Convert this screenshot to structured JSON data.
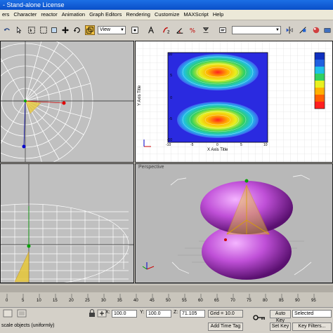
{
  "window": {
    "title": "- Stand-alone License"
  },
  "menu": [
    "ers",
    "Character",
    "reactor",
    "Animation",
    "Graph Editors",
    "Rendering",
    "Customize",
    "MAXScript",
    "Help"
  ],
  "toolbar": {
    "view_dropdown": "View"
  },
  "viewports": {
    "top_right": {
      "x_axis_title": "X Axis Title",
      "y_axis_title": "Y Axis Title",
      "x_ticks": [
        "-10",
        "-5",
        "0",
        "5",
        "10"
      ],
      "y_ticks": [
        "10",
        "5",
        "0",
        "-5",
        "-10"
      ]
    },
    "perspective": {
      "label": "Perspective"
    }
  },
  "timeline": {
    "ticks": [
      "0",
      "5",
      "10",
      "15",
      "20",
      "25",
      "30",
      "35",
      "40",
      "45",
      "50",
      "55",
      "60",
      "65",
      "70",
      "75",
      "80",
      "85",
      "90",
      "95"
    ]
  },
  "status": {
    "prompt": "scale objects (uniformly)",
    "x_label": "X:",
    "x_value": "100.0",
    "y_label": "Y:",
    "y_value": "100.0",
    "z_label": "Z:",
    "z_value": "71.105",
    "grid": "Grid = 10.0",
    "add_time_tag": "Add Time Tag",
    "auto_key": "Auto Key",
    "selected": "Selected",
    "set_key": "Set Key",
    "key_filters": "Key Filters..."
  },
  "colors": {
    "accent": "#f0c040",
    "viewport_bg": "#c0c0c0",
    "sphere": "#c050d8",
    "plot_bg": "#2a2ae0"
  }
}
